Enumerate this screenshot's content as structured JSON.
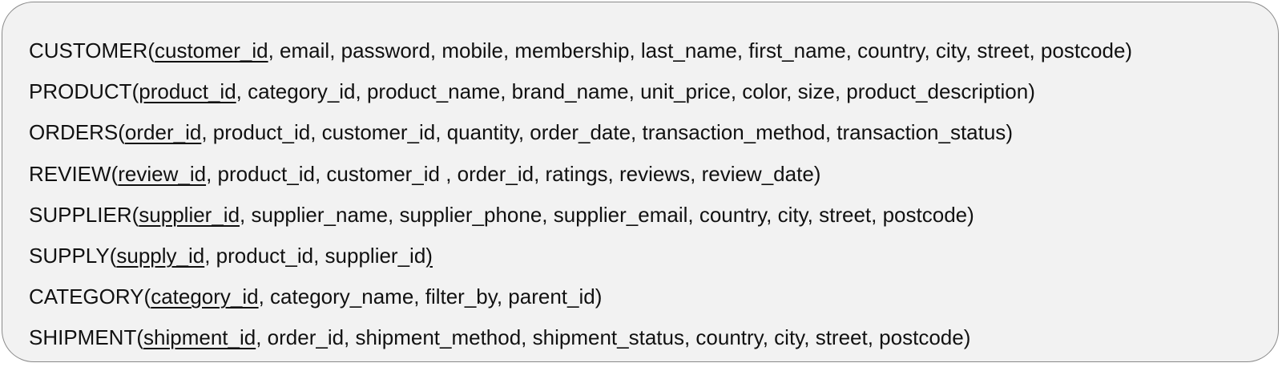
{
  "relations": [
    {
      "name": "CUSTOMER",
      "pk": "customer_id",
      "rest": ", email, password, mobile, membership, last_name, first_name, country, city, street, postcode",
      "close": ")"
    },
    {
      "name": "PRODUCT",
      "pk": "product_id",
      "rest": ", category_id, product_name, brand_name, unit_price, color, size, product_description",
      "close": ")"
    },
    {
      "name": "ORDERS",
      "pk": "order_id",
      "rest": ", product_id, customer_id, quantity, order_date, transaction_method, transaction_status",
      "close": ")"
    },
    {
      "name": "REVIEW",
      "pk": "review_id",
      "rest": ", product_id, customer_id , order_id, ratings, reviews, review_date",
      "close": ")"
    },
    {
      "name": "SUPPLIER",
      "pk": "supplier_id",
      "rest": ", supplier_name, supplier_phone, supplier_email, country, city, street, postcode",
      "close": ")"
    },
    {
      "name": "SUPPLY",
      "pk": "supply_id",
      "rest": ", product_id, supplier_id",
      "close": ")"
    },
    {
      "name": "CATEGORY",
      "pk": "category_id",
      "rest": ", category_name, filter_by, parent_id",
      "close": ")"
    },
    {
      "name": "SHIPMENT",
      "pk": "shipment_id",
      "rest": ", order_id, shipment_method, shipment_status, country, city, street, postcode",
      "close": ")"
    }
  ]
}
